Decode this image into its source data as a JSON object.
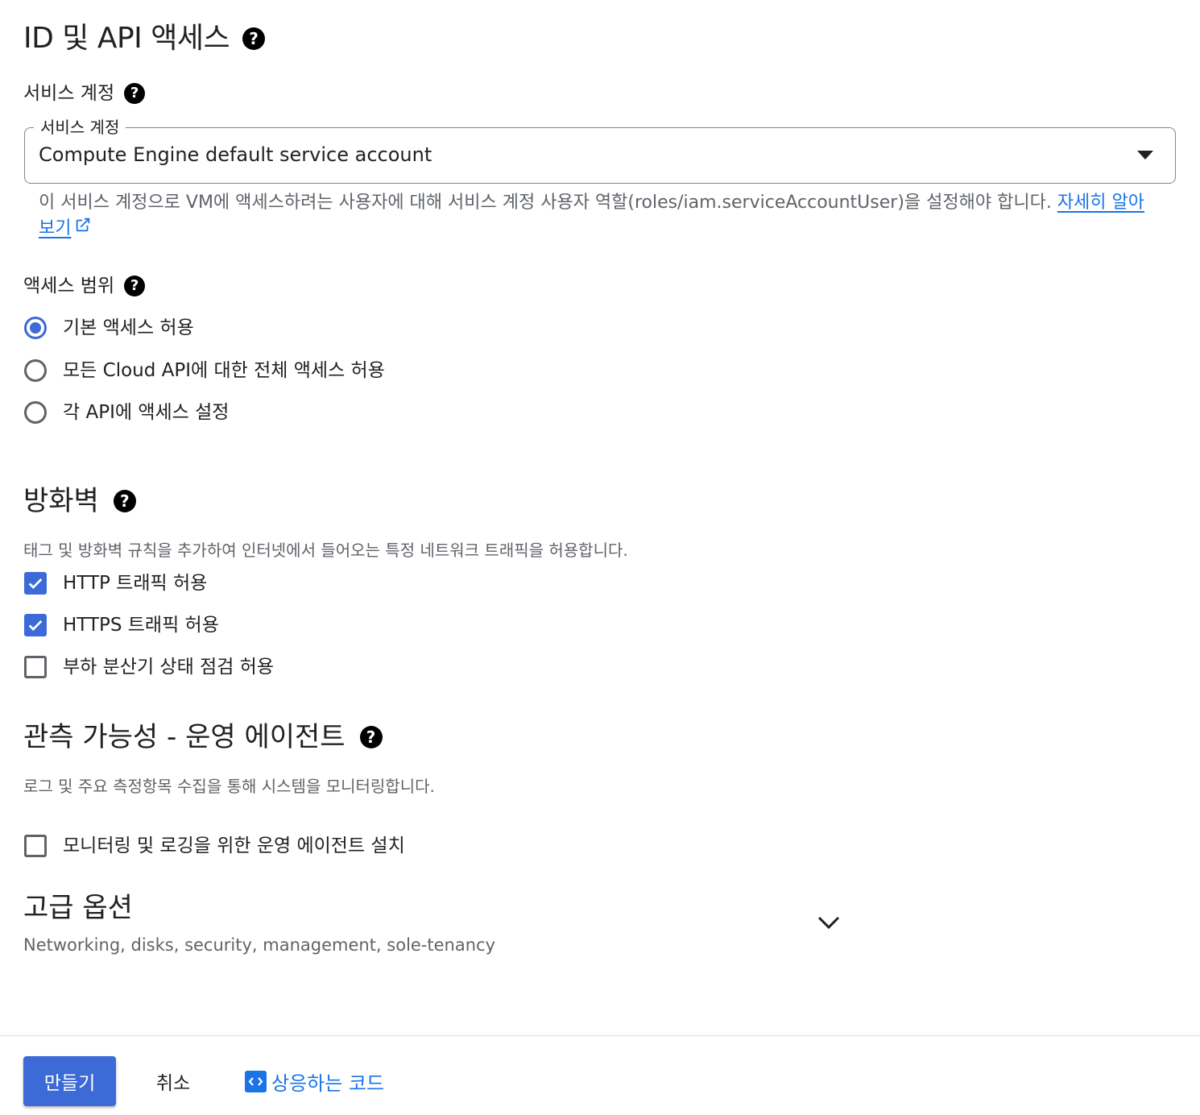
{
  "identity": {
    "title": "ID 및 API 액세스",
    "service_account_label": "서비스 계정",
    "field_legend": "서비스 계정",
    "field_value": "Compute Engine default service account",
    "hint_text": "이 서비스 계정으로 VM에 액세스하려는 사용자에 대해 서비스 계정 사용자 역할(roles/iam.serviceAccountUser)을 설정해야 합니다. ",
    "learn_more": "자세히 알아보기"
  },
  "access_scope": {
    "label": "액세스 범위",
    "options": [
      {
        "label": "기본 액세스 허용",
        "selected": true
      },
      {
        "label": "모든 Cloud API에 대한 전체 액세스 허용",
        "selected": false
      },
      {
        "label": "각 API에 액세스 설정",
        "selected": false
      }
    ]
  },
  "firewall": {
    "title": "방화벽",
    "description": "태그 및 방화벽 규칙을 추가하여 인터넷에서 들어오는 특정 네트워크 트래픽을 허용합니다.",
    "options": [
      {
        "label": "HTTP 트래픽 허용",
        "checked": true
      },
      {
        "label": "HTTPS 트래픽 허용",
        "checked": true
      },
      {
        "label": "부하 분산기 상태 점검 허용",
        "checked": false
      }
    ]
  },
  "observability": {
    "title": "관측 가능성 - 운영 에이전트",
    "description": "로그 및 주요 측정항목 수집을 통해 시스템을 모니터링합니다.",
    "option_label": "모니터링 및 로깅을 위한 운영 에이전트 설치",
    "option_checked": false
  },
  "advanced": {
    "title": "고급 옵션",
    "subtitle": "Networking, disks, security, management, sole-tenancy"
  },
  "actions": {
    "create": "만들기",
    "cancel": "취소",
    "equivalent_code": "상응하는 코드"
  },
  "icons": {
    "help": "help-icon",
    "dropdown": "dropdown-caret-icon",
    "external": "external-link-icon",
    "expand": "chevron-down-icon",
    "code": "code-icon"
  },
  "colors": {
    "accent": "#3c6ad6",
    "link": "#1a73e8"
  }
}
